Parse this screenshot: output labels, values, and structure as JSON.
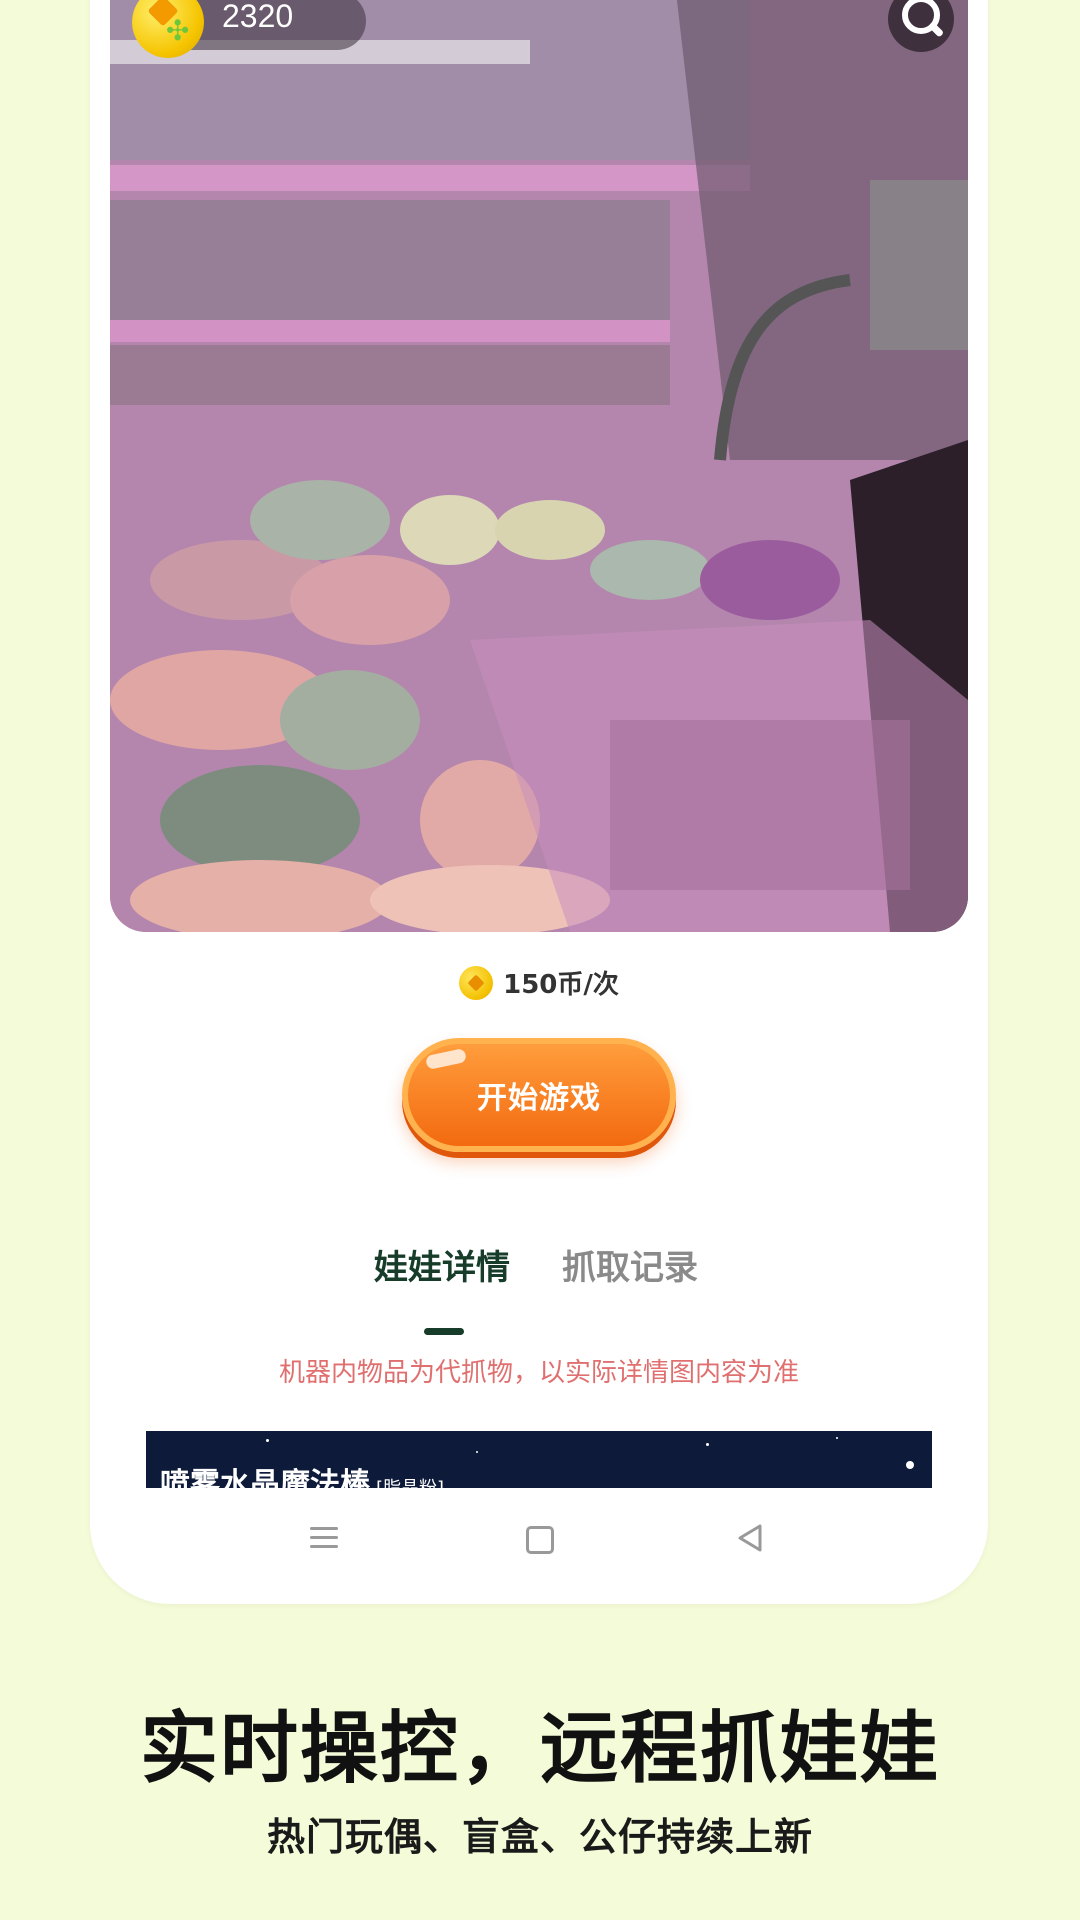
{
  "game": {
    "coin_balance": "2320",
    "price_label": "150币/次",
    "start_button": "开始游戏"
  },
  "tabs": [
    {
      "label": "娃娃详情",
      "active": true
    },
    {
      "label": "抓取记录",
      "active": false
    }
  ],
  "notice": "机器内物品为代抓物，以实际详情图内容为准",
  "banner": {
    "title": "喷雾水晶魔法棒",
    "tag": "[脂晶粉]"
  },
  "promo": {
    "headline": "实时操控，远程抓娃娃",
    "subline": "热门玩偶、盲盒、公仔持续上新"
  },
  "colors": {
    "page_background": "#f4fbd8",
    "start_button": "#f36a10",
    "active_tab": "#173d2a",
    "notice_text": "#e07070"
  },
  "icons": [
    "coin-icon",
    "magnifier-icon",
    "nav-menu-icon",
    "nav-home-icon",
    "nav-back-icon"
  ]
}
